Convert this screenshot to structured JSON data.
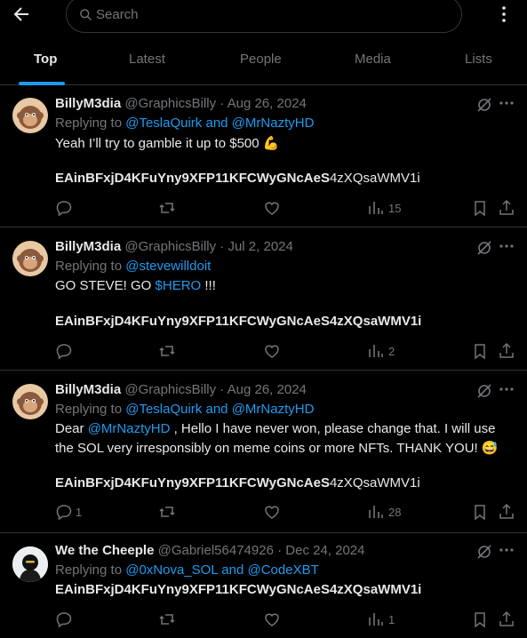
{
  "search": {
    "placeholder": "Search"
  },
  "tabs": [
    "Top",
    "Latest",
    "People",
    "Media",
    "Lists"
  ],
  "tweets": [
    {
      "name": "BillyM3dia",
      "handle": "@GraphicsBilly",
      "date": "Aug 26, 2024",
      "replying_prefix": "Replying to",
      "replying_link1": "@TeslaQuirk",
      "replying_and": "and",
      "replying_link2": "@MrNaztyHD",
      "body1": "Yeah I’ll try to gamble it up to $500 💪",
      "addr_bold": "EAinBFxjD4KFuYny9XFP11KFCWyGNcAeS",
      "addr_rest": "4zXQsaWMV1i",
      "replies": "",
      "views": "15"
    },
    {
      "name": "BillyM3dia",
      "handle": "@GraphicsBilly",
      "date": "Jul 2, 2024",
      "replying_prefix": "Replying to",
      "replying_link1": "@stevewilldoit",
      "body_pre": "GO STEVE! GO ",
      "body_link": "$HERO",
      "body_post": " !!!",
      "addr_bold": "EAinBFxjD4KFuYny9XFP11KFCWyGNcAeS4zXQsaWMV1i",
      "replies": "",
      "views": "2"
    },
    {
      "name": "BillyM3dia",
      "handle": "@GraphicsBilly",
      "date": "Aug 26, 2024",
      "replying_prefix": "Replying to",
      "replying_link1": "@TeslaQuirk",
      "replying_and": "and",
      "replying_link2": "@MrNaztyHD",
      "body_pre": "Dear ",
      "body_link": "@MrNaztyHD",
      "body_post": " , Hello I have never won, please change that. I will use",
      "body2": "the SOL very irresponsibly on meme coins or more NFTs. THANK YOU! 😅",
      "addr_bold": "EAinBFxjD4KFuYny9XFP11KFCWyGNcAeS",
      "addr_rest": "4zXQsaWMV1i",
      "replies": "1",
      "views": "28"
    },
    {
      "name": "We the Cheeple",
      "handle": "@Gabriel56474926",
      "date": "Dec 24, 2024",
      "replying_prefix": "Replying to",
      "replying_link1": "@0xNova_SOL",
      "replying_and": "and",
      "replying_link2": "@CodeXBT",
      "addr_bold": "EAinBFxjD4KFuYny9XFP11KFCWyGNcAeS4zXQsaWMV1i",
      "replies": "",
      "views": "1"
    }
  ],
  "meta_sep": "·",
  "colors": {
    "accent": "#1d9bf0",
    "muted": "#71767b",
    "text": "#e7e9ea",
    "border": "#2f3336"
  }
}
